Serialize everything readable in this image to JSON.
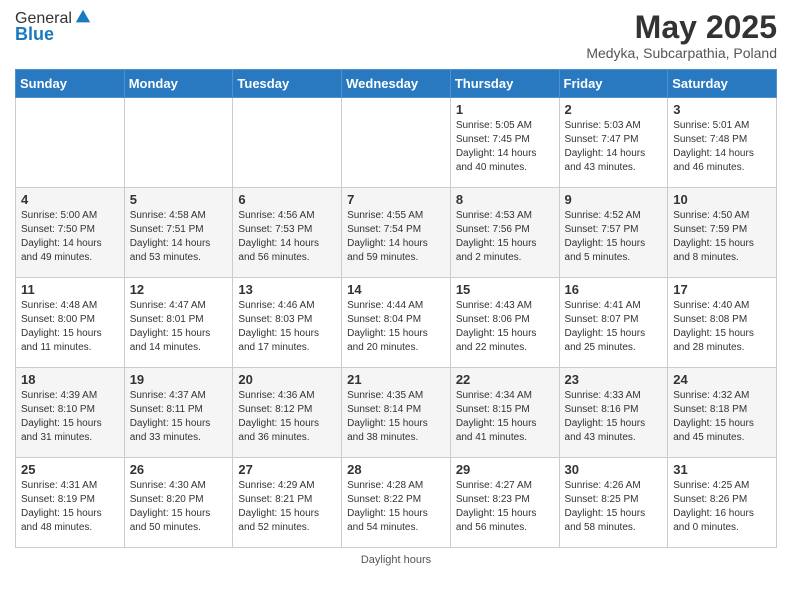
{
  "header": {
    "logo_general": "General",
    "logo_blue": "Blue",
    "month_title": "May 2025",
    "location": "Medyka, Subcarpathia, Poland"
  },
  "days_of_week": [
    "Sunday",
    "Monday",
    "Tuesday",
    "Wednesday",
    "Thursday",
    "Friday",
    "Saturday"
  ],
  "footer": {
    "note": "Daylight hours"
  },
  "weeks": [
    [
      {
        "day": "",
        "info": ""
      },
      {
        "day": "",
        "info": ""
      },
      {
        "day": "",
        "info": ""
      },
      {
        "day": "",
        "info": ""
      },
      {
        "day": "1",
        "info": "Sunrise: 5:05 AM\nSunset: 7:45 PM\nDaylight: 14 hours\nand 40 minutes."
      },
      {
        "day": "2",
        "info": "Sunrise: 5:03 AM\nSunset: 7:47 PM\nDaylight: 14 hours\nand 43 minutes."
      },
      {
        "day": "3",
        "info": "Sunrise: 5:01 AM\nSunset: 7:48 PM\nDaylight: 14 hours\nand 46 minutes."
      }
    ],
    [
      {
        "day": "4",
        "info": "Sunrise: 5:00 AM\nSunset: 7:50 PM\nDaylight: 14 hours\nand 49 minutes."
      },
      {
        "day": "5",
        "info": "Sunrise: 4:58 AM\nSunset: 7:51 PM\nDaylight: 14 hours\nand 53 minutes."
      },
      {
        "day": "6",
        "info": "Sunrise: 4:56 AM\nSunset: 7:53 PM\nDaylight: 14 hours\nand 56 minutes."
      },
      {
        "day": "7",
        "info": "Sunrise: 4:55 AM\nSunset: 7:54 PM\nDaylight: 14 hours\nand 59 minutes."
      },
      {
        "day": "8",
        "info": "Sunrise: 4:53 AM\nSunset: 7:56 PM\nDaylight: 15 hours\nand 2 minutes."
      },
      {
        "day": "9",
        "info": "Sunrise: 4:52 AM\nSunset: 7:57 PM\nDaylight: 15 hours\nand 5 minutes."
      },
      {
        "day": "10",
        "info": "Sunrise: 4:50 AM\nSunset: 7:59 PM\nDaylight: 15 hours\nand 8 minutes."
      }
    ],
    [
      {
        "day": "11",
        "info": "Sunrise: 4:48 AM\nSunset: 8:00 PM\nDaylight: 15 hours\nand 11 minutes."
      },
      {
        "day": "12",
        "info": "Sunrise: 4:47 AM\nSunset: 8:01 PM\nDaylight: 15 hours\nand 14 minutes."
      },
      {
        "day": "13",
        "info": "Sunrise: 4:46 AM\nSunset: 8:03 PM\nDaylight: 15 hours\nand 17 minutes."
      },
      {
        "day": "14",
        "info": "Sunrise: 4:44 AM\nSunset: 8:04 PM\nDaylight: 15 hours\nand 20 minutes."
      },
      {
        "day": "15",
        "info": "Sunrise: 4:43 AM\nSunset: 8:06 PM\nDaylight: 15 hours\nand 22 minutes."
      },
      {
        "day": "16",
        "info": "Sunrise: 4:41 AM\nSunset: 8:07 PM\nDaylight: 15 hours\nand 25 minutes."
      },
      {
        "day": "17",
        "info": "Sunrise: 4:40 AM\nSunset: 8:08 PM\nDaylight: 15 hours\nand 28 minutes."
      }
    ],
    [
      {
        "day": "18",
        "info": "Sunrise: 4:39 AM\nSunset: 8:10 PM\nDaylight: 15 hours\nand 31 minutes."
      },
      {
        "day": "19",
        "info": "Sunrise: 4:37 AM\nSunset: 8:11 PM\nDaylight: 15 hours\nand 33 minutes."
      },
      {
        "day": "20",
        "info": "Sunrise: 4:36 AM\nSunset: 8:12 PM\nDaylight: 15 hours\nand 36 minutes."
      },
      {
        "day": "21",
        "info": "Sunrise: 4:35 AM\nSunset: 8:14 PM\nDaylight: 15 hours\nand 38 minutes."
      },
      {
        "day": "22",
        "info": "Sunrise: 4:34 AM\nSunset: 8:15 PM\nDaylight: 15 hours\nand 41 minutes."
      },
      {
        "day": "23",
        "info": "Sunrise: 4:33 AM\nSunset: 8:16 PM\nDaylight: 15 hours\nand 43 minutes."
      },
      {
        "day": "24",
        "info": "Sunrise: 4:32 AM\nSunset: 8:18 PM\nDaylight: 15 hours\nand 45 minutes."
      }
    ],
    [
      {
        "day": "25",
        "info": "Sunrise: 4:31 AM\nSunset: 8:19 PM\nDaylight: 15 hours\nand 48 minutes."
      },
      {
        "day": "26",
        "info": "Sunrise: 4:30 AM\nSunset: 8:20 PM\nDaylight: 15 hours\nand 50 minutes."
      },
      {
        "day": "27",
        "info": "Sunrise: 4:29 AM\nSunset: 8:21 PM\nDaylight: 15 hours\nand 52 minutes."
      },
      {
        "day": "28",
        "info": "Sunrise: 4:28 AM\nSunset: 8:22 PM\nDaylight: 15 hours\nand 54 minutes."
      },
      {
        "day": "29",
        "info": "Sunrise: 4:27 AM\nSunset: 8:23 PM\nDaylight: 15 hours\nand 56 minutes."
      },
      {
        "day": "30",
        "info": "Sunrise: 4:26 AM\nSunset: 8:25 PM\nDaylight: 15 hours\nand 58 minutes."
      },
      {
        "day": "31",
        "info": "Sunrise: 4:25 AM\nSunset: 8:26 PM\nDaylight: 16 hours\nand 0 minutes."
      }
    ]
  ]
}
